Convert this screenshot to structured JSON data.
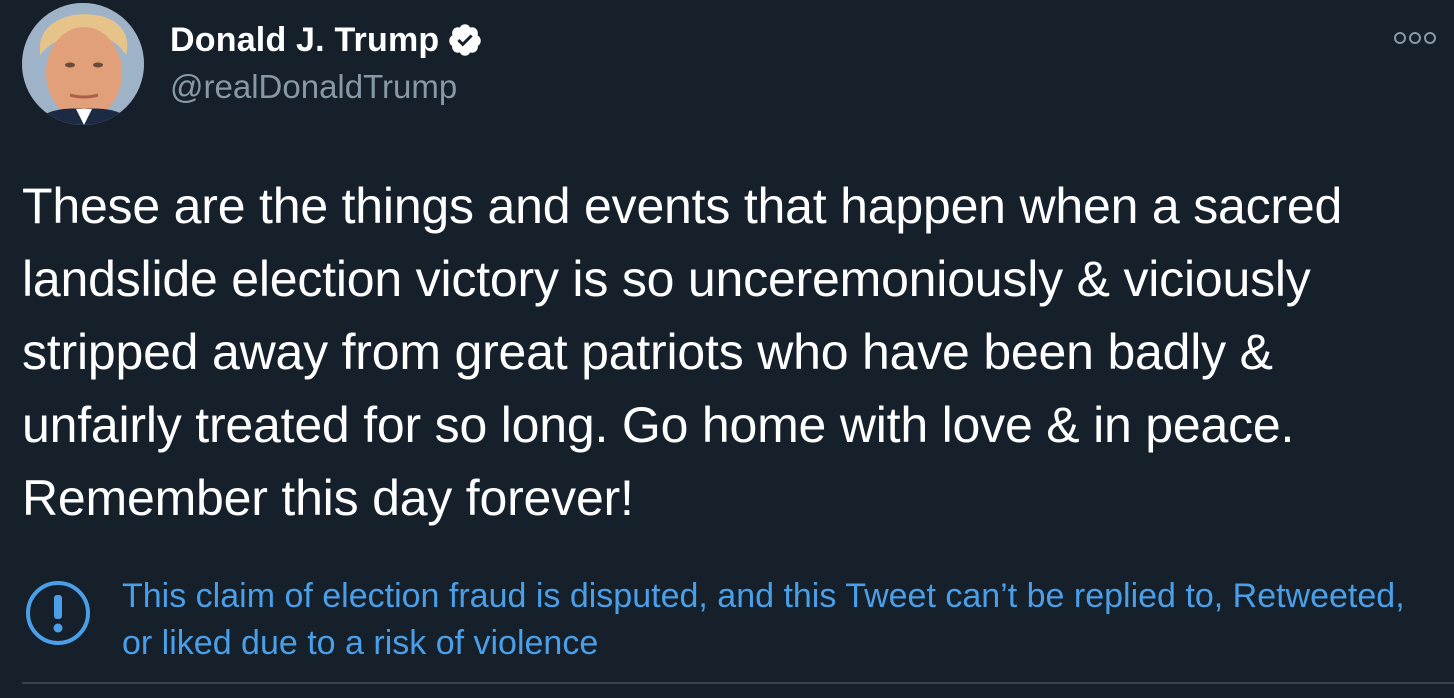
{
  "tweet": {
    "author": {
      "display_name": "Donald J. Trump",
      "handle": "@realDonaldTrump",
      "verified_icon": "verified-badge-icon",
      "avatar": "avatar-photo"
    },
    "more_icon": "more-options-icon",
    "text": "These are the things and events that happen when a sacred landslide election victory is so unceremoniously & viciously stripped away from great patriots who have been badly & unfairly treated for so long. Go home with love & in peace. Remember this day forever!",
    "notice": {
      "icon": "exclamation-circle-icon",
      "text": "This claim of election fraud is disputed, and this Tweet can’t be replied to, Retweeted, or liked due to a risk of violence"
    }
  },
  "colors": {
    "background": "#15202b",
    "text_primary": "#ffffff",
    "text_secondary": "#8899a6",
    "notice_blue": "#4a9fe8",
    "divider": "#38444d"
  }
}
